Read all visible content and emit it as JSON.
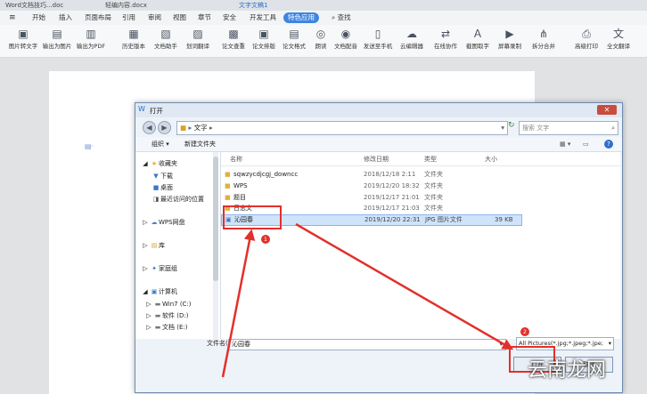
{
  "doc_tabs": [
    "Word文档技巧...doc",
    "轻编内容.docx",
    "文字文稿1"
  ],
  "menu": {
    "items": [
      "开始",
      "插入",
      "页面布局",
      "引用",
      "审阅",
      "视图",
      "章节",
      "安全",
      "开发工具",
      "特色应用"
    ],
    "active": "特色应用",
    "search_label": "查找"
  },
  "ribbon": {
    "buttons": [
      "图片转文字",
      "输出为图片",
      "输出为PDF",
      "历史版本",
      "文档助手",
      "划词翻译",
      "论文查重",
      "论文排版",
      "论文格式",
      "朗读",
      "文档配音",
      "发送至手机",
      "云编辑器",
      "在线协作",
      "截图取字",
      "屏幕录制",
      "拆分合并",
      "高级打印",
      "全文翻译"
    ]
  },
  "dialog": {
    "title": "打开",
    "close_label": "✕",
    "address": [
      "文字"
    ],
    "search_placeholder": "搜索 文字",
    "organize_label": "组织 ▾",
    "newfolder_label": "新建文件夹",
    "nav": {
      "favorites": "收藏夹",
      "download": "下载",
      "desktop": "桌面",
      "recent": "最近访问的位置",
      "wps": "WPS网盘",
      "library": "库",
      "homegroup": "家庭组",
      "computer": "计算机",
      "drive_c": "Win7 (C:)",
      "drive_d": "软件 (D:)",
      "drive_e": "文档 (E:)"
    },
    "columns": {
      "name": "名称",
      "modified": "修改日期",
      "type": "类型",
      "size": "大小"
    },
    "files": [
      {
        "name": "sqwzycdjcgj_downcc",
        "modified": "2018/12/18 2:11",
        "type": "文件夹",
        "size": ""
      },
      {
        "name": "WPS",
        "modified": "2019/12/20 18:32",
        "type": "文件夹",
        "size": ""
      },
      {
        "name": "题目",
        "modified": "2019/12/17 21:01",
        "type": "文件夹",
        "size": ""
      },
      {
        "name": "日志文",
        "modified": "2019/12/17 21:03",
        "type": "文件夹",
        "size": ""
      },
      {
        "name": "沁园春",
        "modified": "2019/12/20 22:31",
        "type": "JPG 图片文件",
        "size": "39 KB"
      }
    ],
    "filename_label": "文件名(N):",
    "filename_value": "沁园春",
    "filter_value": "All Pictures(*.jpg;*.jpeg;*.jpe;",
    "open_label": "打开",
    "cancel_label": "取消"
  },
  "annotations": {
    "badge1": "1",
    "badge2": "2"
  },
  "watermark": "云南龙网",
  "colors": {
    "accent": "#3d86e0",
    "annotation": "#e2302a"
  }
}
